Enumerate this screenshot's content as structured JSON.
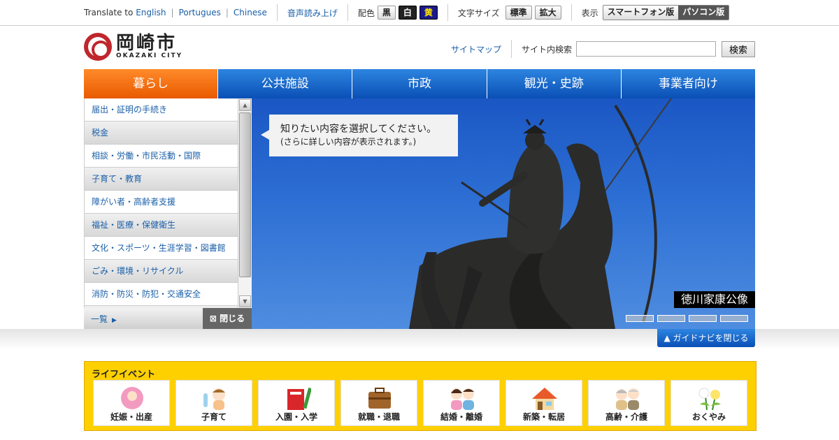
{
  "topbar": {
    "translate_prefix": "Translate to",
    "languages": [
      "English",
      "Portugues",
      "Chinese"
    ],
    "read_aloud": "音声読み上げ",
    "color_label": "配色",
    "colors": [
      "黒",
      "白",
      "黄"
    ],
    "font_size_label": "文字サイズ",
    "font_sizes": [
      "標準",
      "拡大"
    ],
    "display_label": "表示",
    "display_smartphone": "スマートフォン版",
    "display_pc": "パソコン版"
  },
  "header": {
    "logo_jp": "岡崎市",
    "logo_en": "OKAZAKI CITY",
    "sitemap": "サイトマップ",
    "search_label": "サイト内検索",
    "search_value": "",
    "search_button": "検索"
  },
  "nav": [
    "暮らし",
    "公共施設",
    "市政",
    "観光・史跡",
    "事業者向け"
  ],
  "sidebar": {
    "items": [
      {
        "label": "届出・証明の手続き",
        "alt": false
      },
      {
        "label": "税金",
        "alt": true
      },
      {
        "label": "相談・労働・市民活動・国際",
        "alt": false
      },
      {
        "label": "子育て・教育",
        "alt": true
      },
      {
        "label": "障がい者・高齢者支援",
        "alt": false
      },
      {
        "label": "福祉・医療・保健衛生",
        "alt": true
      },
      {
        "label": "文化・スポーツ・生涯学習・図書館",
        "alt": false
      },
      {
        "label": "ごみ・環境・リサイクル",
        "alt": true
      },
      {
        "label": "消防・防災・防犯・交通安全",
        "alt": false
      }
    ],
    "all_label": "一覧",
    "close_label": "閉じる"
  },
  "hero": {
    "balloon_line1": "知りたい内容を選択してください。",
    "balloon_line2": "(さらに詳しい内容が表示されます。)",
    "caption": "徳川家康公像",
    "slide_count": 4
  },
  "guide_close": "ガイドナビを閉じる",
  "life": {
    "title": "ライフイベント",
    "events": [
      {
        "label": "妊娠・出産",
        "icon": "baby-icon",
        "color": "#f39ac0"
      },
      {
        "label": "子育て",
        "icon": "children-icon",
        "color": "#f7c28a"
      },
      {
        "label": "入園・入学",
        "icon": "textbook-icon",
        "color": "#d8262a"
      },
      {
        "label": "就職・退職",
        "icon": "briefcase-icon",
        "color": "#a0642a"
      },
      {
        "label": "結婚・離婚",
        "icon": "couple-icon",
        "color": "#6fb3e0"
      },
      {
        "label": "新築・転居",
        "icon": "house-icon",
        "color": "#e85a2a"
      },
      {
        "label": "高齢・介護",
        "icon": "elderly-icon",
        "color": "#9a8a6a"
      },
      {
        "label": "おくやみ",
        "icon": "flowers-icon",
        "color": "#7cbf3a"
      }
    ]
  }
}
